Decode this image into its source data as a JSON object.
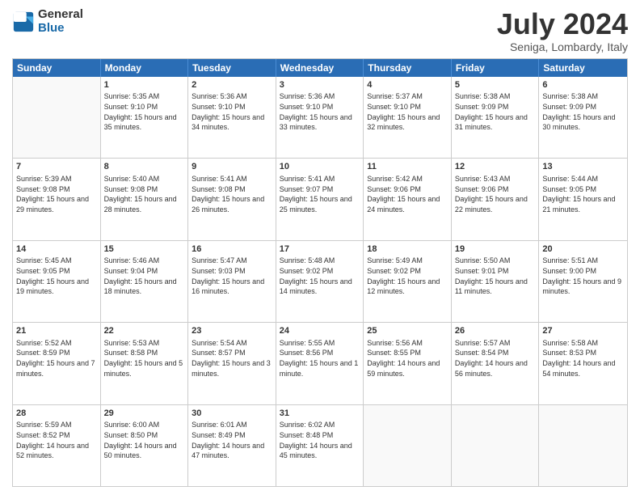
{
  "header": {
    "logo_general": "General",
    "logo_blue": "Blue",
    "month_title": "July 2024",
    "location": "Seniga, Lombardy, Italy"
  },
  "days_of_week": [
    "Sunday",
    "Monday",
    "Tuesday",
    "Wednesday",
    "Thursday",
    "Friday",
    "Saturday"
  ],
  "weeks": [
    [
      {
        "day": "",
        "empty": true
      },
      {
        "day": "1",
        "sunrise": "Sunrise: 5:35 AM",
        "sunset": "Sunset: 9:10 PM",
        "daylight": "Daylight: 15 hours and 35 minutes."
      },
      {
        "day": "2",
        "sunrise": "Sunrise: 5:36 AM",
        "sunset": "Sunset: 9:10 PM",
        "daylight": "Daylight: 15 hours and 34 minutes."
      },
      {
        "day": "3",
        "sunrise": "Sunrise: 5:36 AM",
        "sunset": "Sunset: 9:10 PM",
        "daylight": "Daylight: 15 hours and 33 minutes."
      },
      {
        "day": "4",
        "sunrise": "Sunrise: 5:37 AM",
        "sunset": "Sunset: 9:10 PM",
        "daylight": "Daylight: 15 hours and 32 minutes."
      },
      {
        "day": "5",
        "sunrise": "Sunrise: 5:38 AM",
        "sunset": "Sunset: 9:09 PM",
        "daylight": "Daylight: 15 hours and 31 minutes."
      },
      {
        "day": "6",
        "sunrise": "Sunrise: 5:38 AM",
        "sunset": "Sunset: 9:09 PM",
        "daylight": "Daylight: 15 hours and 30 minutes."
      }
    ],
    [
      {
        "day": "7",
        "sunrise": "Sunrise: 5:39 AM",
        "sunset": "Sunset: 9:08 PM",
        "daylight": "Daylight: 15 hours and 29 minutes."
      },
      {
        "day": "8",
        "sunrise": "Sunrise: 5:40 AM",
        "sunset": "Sunset: 9:08 PM",
        "daylight": "Daylight: 15 hours and 28 minutes."
      },
      {
        "day": "9",
        "sunrise": "Sunrise: 5:41 AM",
        "sunset": "Sunset: 9:08 PM",
        "daylight": "Daylight: 15 hours and 26 minutes."
      },
      {
        "day": "10",
        "sunrise": "Sunrise: 5:41 AM",
        "sunset": "Sunset: 9:07 PM",
        "daylight": "Daylight: 15 hours and 25 minutes."
      },
      {
        "day": "11",
        "sunrise": "Sunrise: 5:42 AM",
        "sunset": "Sunset: 9:06 PM",
        "daylight": "Daylight: 15 hours and 24 minutes."
      },
      {
        "day": "12",
        "sunrise": "Sunrise: 5:43 AM",
        "sunset": "Sunset: 9:06 PM",
        "daylight": "Daylight: 15 hours and 22 minutes."
      },
      {
        "day": "13",
        "sunrise": "Sunrise: 5:44 AM",
        "sunset": "Sunset: 9:05 PM",
        "daylight": "Daylight: 15 hours and 21 minutes."
      }
    ],
    [
      {
        "day": "14",
        "sunrise": "Sunrise: 5:45 AM",
        "sunset": "Sunset: 9:05 PM",
        "daylight": "Daylight: 15 hours and 19 minutes."
      },
      {
        "day": "15",
        "sunrise": "Sunrise: 5:46 AM",
        "sunset": "Sunset: 9:04 PM",
        "daylight": "Daylight: 15 hours and 18 minutes."
      },
      {
        "day": "16",
        "sunrise": "Sunrise: 5:47 AM",
        "sunset": "Sunset: 9:03 PM",
        "daylight": "Daylight: 15 hours and 16 minutes."
      },
      {
        "day": "17",
        "sunrise": "Sunrise: 5:48 AM",
        "sunset": "Sunset: 9:02 PM",
        "daylight": "Daylight: 15 hours and 14 minutes."
      },
      {
        "day": "18",
        "sunrise": "Sunrise: 5:49 AM",
        "sunset": "Sunset: 9:02 PM",
        "daylight": "Daylight: 15 hours and 12 minutes."
      },
      {
        "day": "19",
        "sunrise": "Sunrise: 5:50 AM",
        "sunset": "Sunset: 9:01 PM",
        "daylight": "Daylight: 15 hours and 11 minutes."
      },
      {
        "day": "20",
        "sunrise": "Sunrise: 5:51 AM",
        "sunset": "Sunset: 9:00 PM",
        "daylight": "Daylight: 15 hours and 9 minutes."
      }
    ],
    [
      {
        "day": "21",
        "sunrise": "Sunrise: 5:52 AM",
        "sunset": "Sunset: 8:59 PM",
        "daylight": "Daylight: 15 hours and 7 minutes."
      },
      {
        "day": "22",
        "sunrise": "Sunrise: 5:53 AM",
        "sunset": "Sunset: 8:58 PM",
        "daylight": "Daylight: 15 hours and 5 minutes."
      },
      {
        "day": "23",
        "sunrise": "Sunrise: 5:54 AM",
        "sunset": "Sunset: 8:57 PM",
        "daylight": "Daylight: 15 hours and 3 minutes."
      },
      {
        "day": "24",
        "sunrise": "Sunrise: 5:55 AM",
        "sunset": "Sunset: 8:56 PM",
        "daylight": "Daylight: 15 hours and 1 minute."
      },
      {
        "day": "25",
        "sunrise": "Sunrise: 5:56 AM",
        "sunset": "Sunset: 8:55 PM",
        "daylight": "Daylight: 14 hours and 59 minutes."
      },
      {
        "day": "26",
        "sunrise": "Sunrise: 5:57 AM",
        "sunset": "Sunset: 8:54 PM",
        "daylight": "Daylight: 14 hours and 56 minutes."
      },
      {
        "day": "27",
        "sunrise": "Sunrise: 5:58 AM",
        "sunset": "Sunset: 8:53 PM",
        "daylight": "Daylight: 14 hours and 54 minutes."
      }
    ],
    [
      {
        "day": "28",
        "sunrise": "Sunrise: 5:59 AM",
        "sunset": "Sunset: 8:52 PM",
        "daylight": "Daylight: 14 hours and 52 minutes."
      },
      {
        "day": "29",
        "sunrise": "Sunrise: 6:00 AM",
        "sunset": "Sunset: 8:50 PM",
        "daylight": "Daylight: 14 hours and 50 minutes."
      },
      {
        "day": "30",
        "sunrise": "Sunrise: 6:01 AM",
        "sunset": "Sunset: 8:49 PM",
        "daylight": "Daylight: 14 hours and 47 minutes."
      },
      {
        "day": "31",
        "sunrise": "Sunrise: 6:02 AM",
        "sunset": "Sunset: 8:48 PM",
        "daylight": "Daylight: 14 hours and 45 minutes."
      },
      {
        "day": "",
        "empty": true
      },
      {
        "day": "",
        "empty": true
      },
      {
        "day": "",
        "empty": true
      }
    ]
  ]
}
